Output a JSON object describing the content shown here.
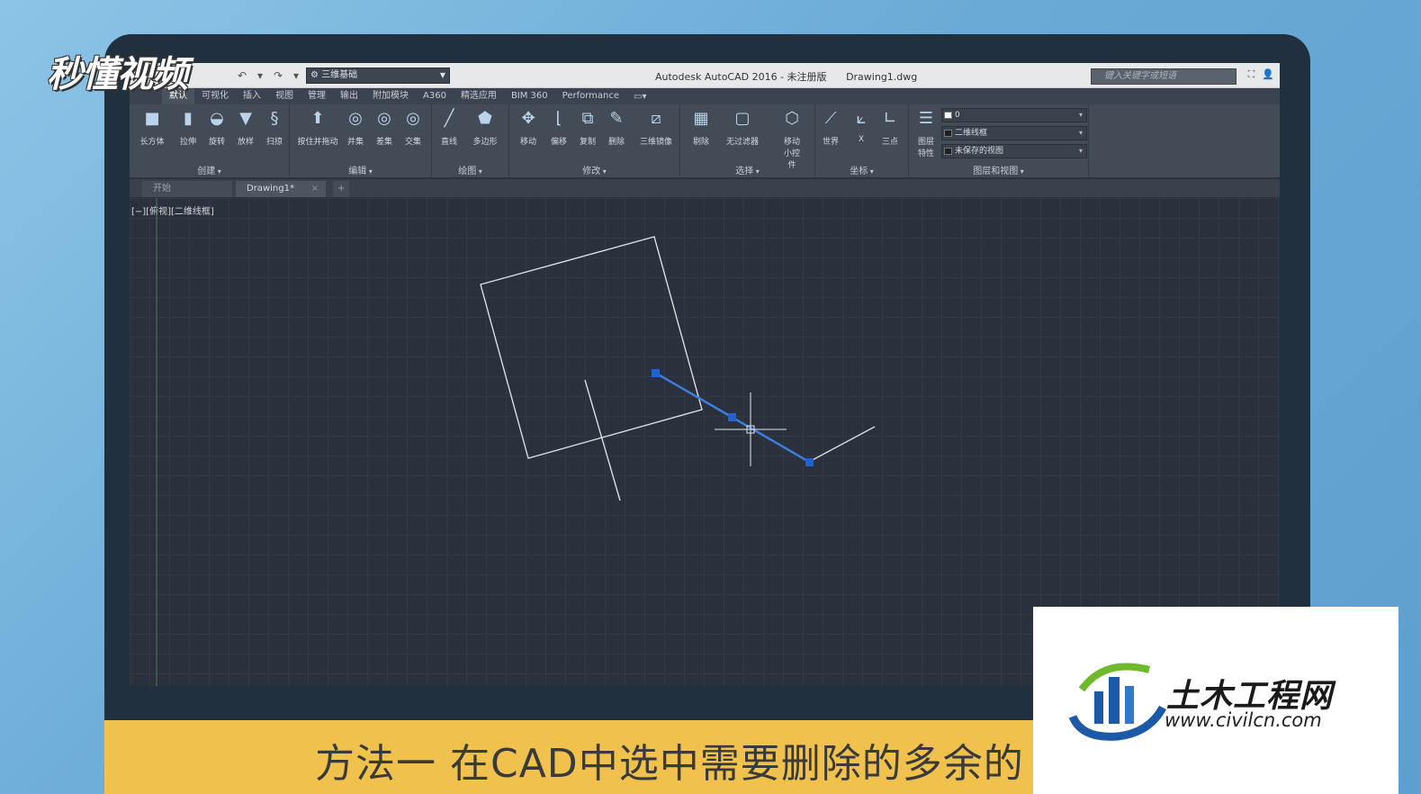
{
  "watermark": {
    "text": "秒懂视频"
  },
  "titlebar": {
    "workspace": "三维基础",
    "app_title": "Autodesk AutoCAD 2016 - 未注册版",
    "document": "Drawing1.dwg",
    "search_placeholder": "键入关键字或短语"
  },
  "ribbon_tabs": [
    "默认",
    "可视化",
    "插入",
    "视图",
    "管理",
    "输出",
    "附加模块",
    "A360",
    "精选应用",
    "BIM 360",
    "Performance"
  ],
  "panels": {
    "create": {
      "title": "创建",
      "tools": [
        "长方体",
        "拉伸",
        "旋转",
        "放样",
        "扫掠"
      ]
    },
    "edit": {
      "title": "编辑",
      "tools": [
        "按住并拖动",
        "并集",
        "差集",
        "交集"
      ]
    },
    "draw": {
      "title": "绘图",
      "tools": [
        "直线",
        "多边形"
      ]
    },
    "modify": {
      "title": "修改",
      "tools": [
        "移动",
        "偏移",
        "复制",
        "删除",
        "三维镜像"
      ]
    },
    "select": {
      "title": "选择",
      "tools": [
        "剔除",
        "无过滤器",
        "移动小控件"
      ]
    },
    "coords": {
      "title": "坐标",
      "tools": [
        "世界",
        "X",
        "三点"
      ]
    },
    "layers": {
      "title": "图层和视图",
      "tool": "图层特性",
      "layer_name": "0",
      "visual_style": "二维线框",
      "view": "未保存的视图"
    }
  },
  "file_tabs": {
    "start": "开始",
    "drawing": "Drawing1*"
  },
  "viewport_label": "[−][俯视][二维线框]",
  "caption": "方法一 在CAD中选中需要删除的多余的",
  "logo": {
    "cn": "土木工程网",
    "url": "www.civilcn.com"
  },
  "colors": {
    "selection": "#3d7fe0",
    "grip": "#1f62d6",
    "caption_bg": "#f0c24d",
    "ribbon_bg": "#434b57"
  }
}
